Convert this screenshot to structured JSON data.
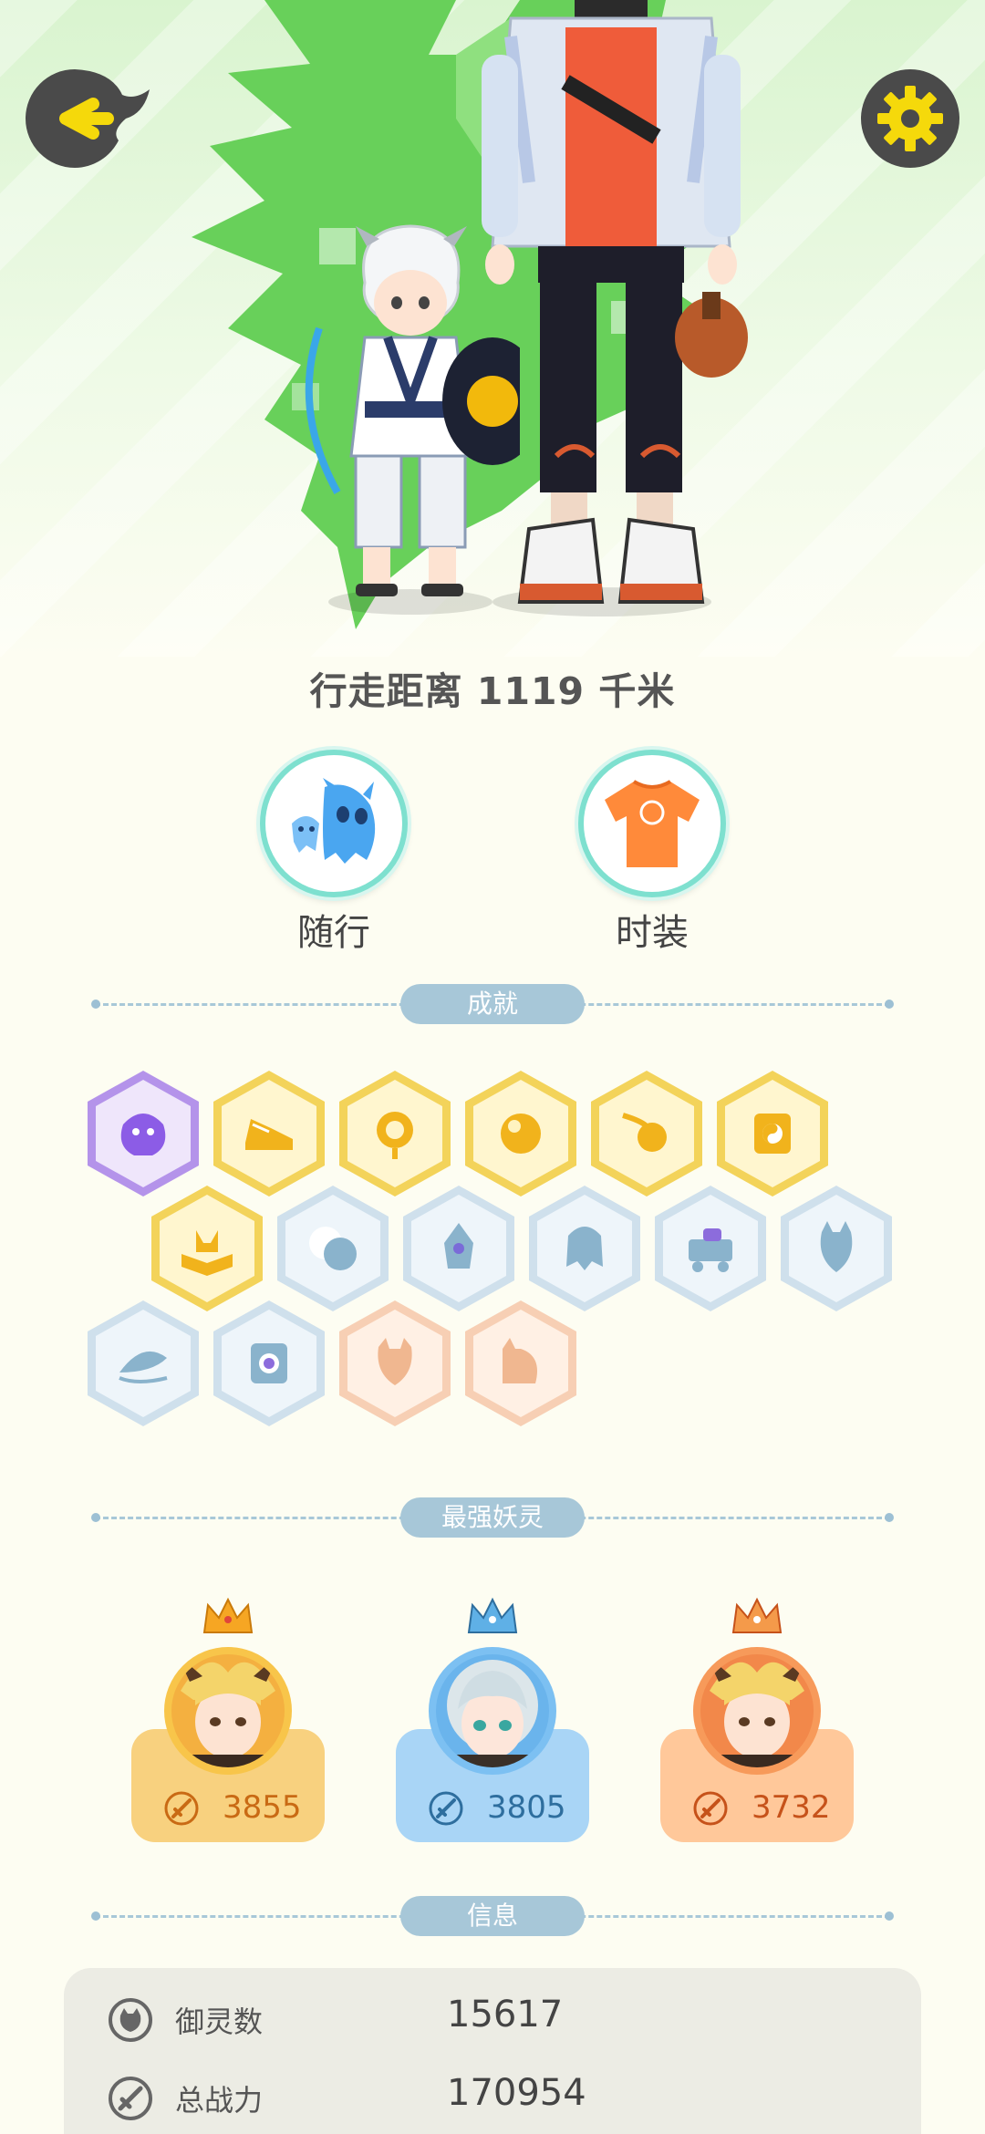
{
  "profile": {
    "distance_text": "行走距离 1119 千米"
  },
  "features": [
    {
      "label": "随行",
      "icon": "ghost-companion-icon"
    },
    {
      "label": "时装",
      "icon": "shirt-icon"
    }
  ],
  "sections": {
    "achievements": "成就",
    "strongest": "最强妖灵",
    "info": "信息"
  },
  "achievements": {
    "rows": [
      [
        "purple-spirit",
        "gold-shoe",
        "gold-sun",
        "gold-orb",
        "gold-comet",
        "gold-yinyang"
      ],
      [
        "gold-book",
        "blue-moon",
        "blue-crystal",
        "blue-spirit",
        "blue-cart",
        "blue-cat"
      ],
      [
        "blue-fish",
        "blue-scroll",
        "peach-demon",
        "peach-cat"
      ]
    ]
  },
  "strongest": [
    {
      "score": "3855",
      "theme": "gold",
      "accent": "#f6cd73",
      "text_color": "#c96a14",
      "crown": "gold-crown-icon"
    },
    {
      "score": "3805",
      "theme": "blue",
      "accent": "#a9d5f6",
      "text_color": "#2e6e9e",
      "crown": "blue-crown-icon"
    },
    {
      "score": "3732",
      "theme": "orange",
      "accent": "#ffc89a",
      "text_color": "#c6521a",
      "crown": "orange-crown-icon"
    }
  ],
  "info": [
    {
      "label": "御灵数",
      "value": "15617",
      "icon": "spirit-count-icon"
    },
    {
      "label": "总战力",
      "value": "170954",
      "icon": "sword-power-icon"
    }
  ],
  "colors": {
    "background": "#fdfdf2",
    "accent_yellow": "#f5d90b",
    "divider": "#a7c7d8",
    "teal_ring": "#7ee0cf"
  }
}
